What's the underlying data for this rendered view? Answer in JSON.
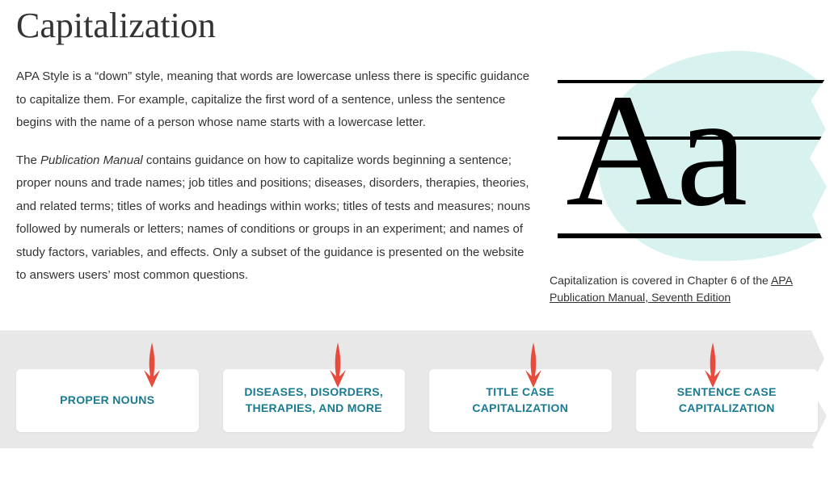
{
  "title": "Capitalization",
  "paragraphs": {
    "p1": "APA Style is a “down” style, meaning that words are lowercase unless there is specific guidance to capitalize them. For example, capitalize the first word of a sentence, unless the sentence begins with the name of a person whose name starts with a lowercase letter.",
    "p2_lead": "The ",
    "p2_italic": "Publication Manual",
    "p2_rest": " contains guidance on how to capitalize words beginning a sentence; proper nouns and trade names; job titles and positions; diseases, disorders, therapies, theories, and related terms; titles of works and headings within works; titles of tests and measures; nouns followed by numerals or letters; names of conditions or groups in an experiment; and names of study factors, variables, and effects. Only a subset of the guidance is presented on the website to answers users’ most common questions."
  },
  "graphic_letters": "Aa",
  "caption": {
    "lead": "Capitalization is covered in Chapter 6 of the ",
    "link": "APA Publication Manual, Seventh Edition"
  },
  "cards": [
    "PROPER NOUNS",
    "DISEASES, DISORDERS, THERAPIES, AND MORE",
    "TITLE CASE CAPITALIZATION",
    "SENTENCE CASE CAPITALIZATION"
  ]
}
